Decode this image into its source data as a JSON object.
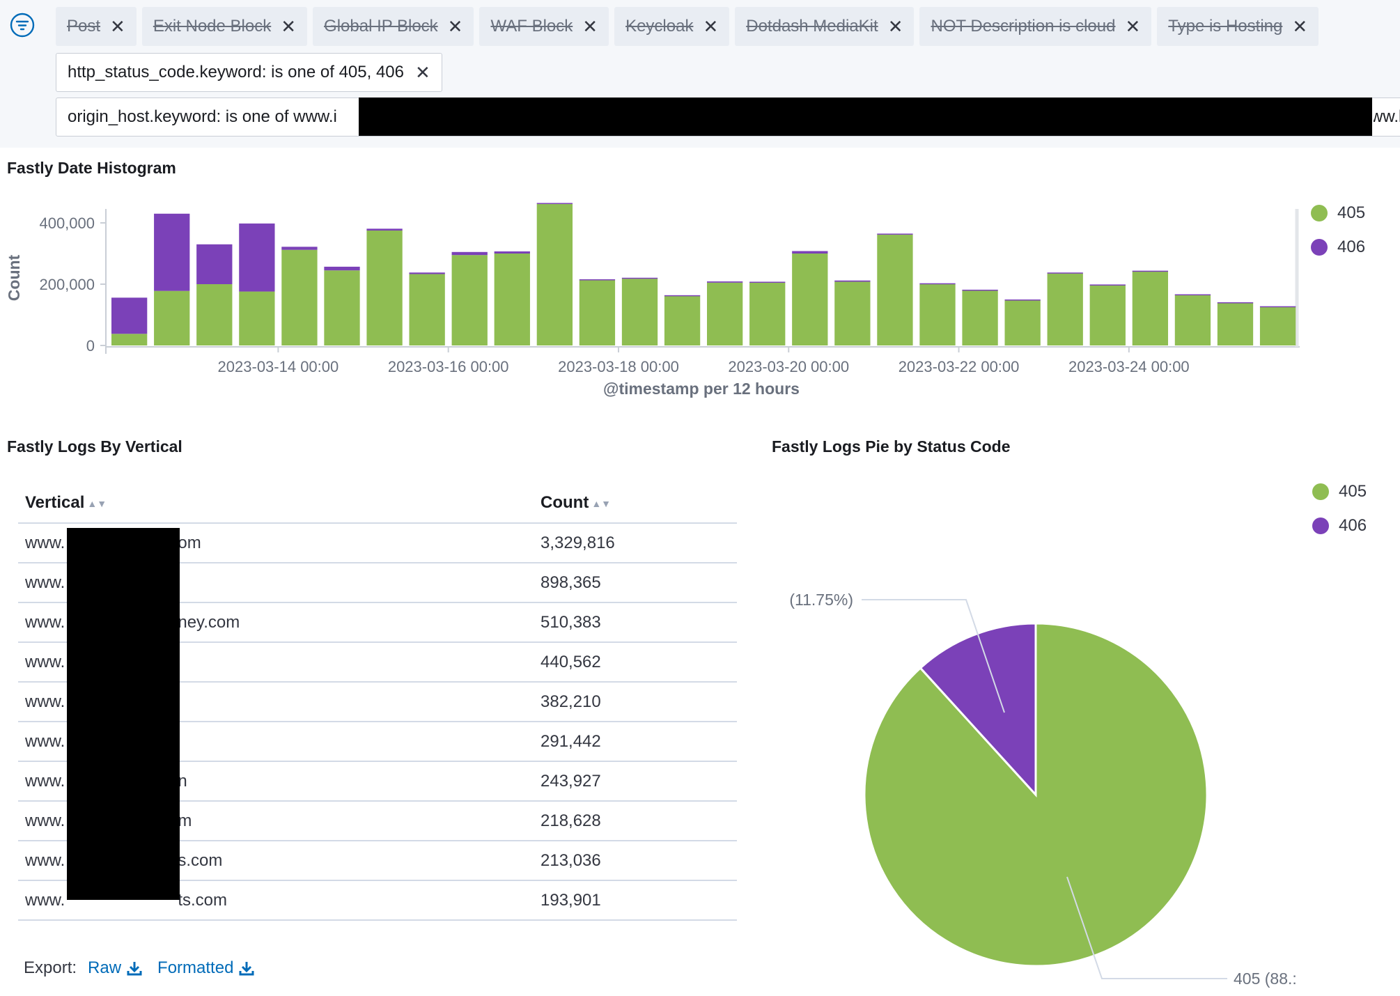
{
  "colors": {
    "c405": "#8fbd52",
    "c406": "#7b41b8",
    "link": "#006bb8"
  },
  "filter_bar": {
    "icon": "filter-menu-icon",
    "disabled_pills": [
      {
        "label": "Post"
      },
      {
        "label": "Exit Node Block"
      },
      {
        "label": "Global IP Block"
      },
      {
        "label": "WAF Block"
      },
      {
        "label": "Keycloak"
      },
      {
        "label": "Dotdash MediaKit"
      },
      {
        "label": "NOT Description is cloud"
      },
      {
        "label": "Type is Hosting"
      }
    ],
    "status_filter": "http_status_code.keyword: is one of 405, 406",
    "host_filter": "origin_host.keyword: is one of www.i",
    "host_filter_tail": "ww.l"
  },
  "histogram": {
    "title": "Fastly Date Histogram",
    "chart_data": {
      "type": "bar",
      "stacked": true,
      "ylabel": "Count",
      "xlabel": "@timestamp per 12 hours",
      "ylim": [
        0,
        540000
      ],
      "y_ticks": [
        "0",
        "200,000",
        "400,000"
      ],
      "x_ticks": [
        "2023-03-14 00:00",
        "2023-03-16 00:00",
        "2023-03-18 00:00",
        "2023-03-20 00:00",
        "2023-03-22 00:00",
        "2023-03-24 00:00"
      ],
      "x_tick_bar_index": [
        3,
        7,
        11,
        15,
        19,
        23
      ],
      "series": [
        {
          "name": "405",
          "values": [
            38000,
            178000,
            200000,
            176000,
            312000,
            245000,
            375000,
            233000,
            295000,
            300000,
            462000,
            213000,
            218000,
            162000,
            205000,
            205000,
            300000,
            208000,
            362000,
            200000,
            180000,
            148000,
            235000,
            197000,
            242000,
            166000,
            140000,
            127000
          ]
        },
        {
          "name": "406",
          "values": [
            118000,
            252000,
            130000,
            222000,
            10000,
            12000,
            6000,
            5000,
            10000,
            7000,
            3000,
            3000,
            3000,
            2000,
            4000,
            3000,
            8000,
            4000,
            3000,
            3000,
            2000,
            2000,
            3000,
            2000,
            2000,
            1000,
            1000,
            1000
          ]
        }
      ],
      "legend": [
        "405",
        "406"
      ],
      "legend_position": "right"
    }
  },
  "vertical_table": {
    "title": "Fastly Logs By Vertical",
    "headers": [
      "Vertical",
      "Count"
    ],
    "rows": [
      {
        "vertical": "www.",
        "suffix": "om",
        "count": "3,329,816"
      },
      {
        "vertical": "www.",
        "suffix": "",
        "count": "898,365"
      },
      {
        "vertical": "www.",
        "suffix": "ney.com",
        "count": "510,383"
      },
      {
        "vertical": "www.",
        "suffix": "",
        "count": "440,562"
      },
      {
        "vertical": "www.",
        "suffix": "",
        "count": "382,210"
      },
      {
        "vertical": "www.",
        "suffix": "",
        "count": "291,442"
      },
      {
        "vertical": "www.",
        "suffix": "n",
        "count": "243,927"
      },
      {
        "vertical": "www.",
        "suffix": "m",
        "count": "218,628"
      },
      {
        "vertical": "www.",
        "suffix": "s.com",
        "count": "213,036"
      },
      {
        "vertical": "www.",
        "suffix": "ts.com",
        "count": "193,901"
      }
    ],
    "export_label": "Export:",
    "export_raw": "Raw",
    "export_formatted": "Formatted"
  },
  "pie": {
    "title": "Fastly Logs Pie by Status Code",
    "chart_data": {
      "type": "pie",
      "slices": [
        {
          "name": "405",
          "percent": 88.25,
          "label": "405 (88.:"
        },
        {
          "name": "406",
          "percent": 11.75,
          "label": "(11.75%)"
        }
      ],
      "legend": [
        "405",
        "406"
      ],
      "legend_position": "top-right"
    }
  }
}
